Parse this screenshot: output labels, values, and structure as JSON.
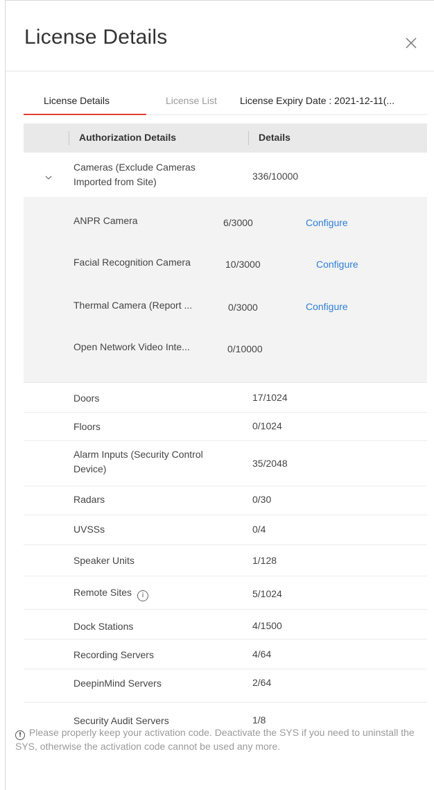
{
  "dialog": {
    "title": "License Details",
    "close_icon": "close-icon"
  },
  "tabs": [
    {
      "label": "License Details",
      "active": true
    },
    {
      "label": "License List",
      "active": false
    }
  ],
  "expiry": "License Expiry Date : 2021-12-11(...",
  "table": {
    "headers": [
      "Authorization Details",
      "Details"
    ],
    "cameras": {
      "name_line1": "Cameras (Exclude Cameras",
      "name_line2": "Imported from Site)",
      "value": "336/10000",
      "expand_icon": "chevron-down-icon",
      "sub": [
        {
          "name": "ANPR Camera",
          "value": "6/3000",
          "action": "Configure"
        },
        {
          "name": "Facial Recognition Camera",
          "value": "10/3000",
          "action": "Configure"
        },
        {
          "name": "Thermal Camera (Report ...",
          "value": "0/3000",
          "action": "Configure"
        },
        {
          "name": "Open Network Video Inte...",
          "value": "0/10000",
          "action": ""
        }
      ]
    },
    "rows": [
      {
        "name": "Doors",
        "value": "17/1024"
      },
      {
        "name": "Floors",
        "value": "0/1024"
      },
      {
        "name_line1": "Alarm Inputs (Security Control",
        "name_line2": "Device)",
        "value": "35/2048"
      },
      {
        "name": "Radars",
        "value": "0/30"
      },
      {
        "name": "UVSSs",
        "value": "0/4"
      },
      {
        "name": "Speaker Units",
        "value": "1/128"
      },
      {
        "name": "Remote Sites",
        "value": "5/1024",
        "icon": "info-icon"
      },
      {
        "name": "Dock Stations",
        "value": "4/1500"
      },
      {
        "name": "Recording Servers",
        "value": "4/64"
      },
      {
        "name": "DeepinMind Servers",
        "value": "2/64"
      },
      {
        "name": "Security Audit Servers",
        "value": "1/8"
      }
    ]
  },
  "notice": {
    "icon": "!",
    "text": "Please properly keep your activation code. Deactivate the SYS if you need to uninstall the SYS, otherwise the activation code cannot be used any more."
  },
  "colors": {
    "accent": "#e33e32",
    "link": "#2f7fd7"
  }
}
